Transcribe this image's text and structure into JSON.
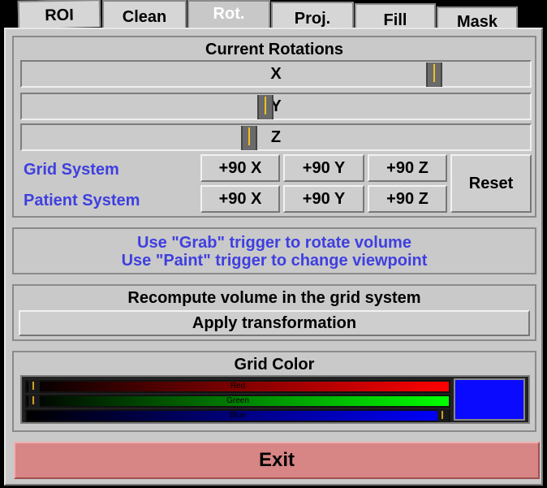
{
  "tabs": [
    {
      "label": "ROI"
    },
    {
      "label": "Clean"
    },
    {
      "label": "Rot."
    },
    {
      "label": "Proj."
    },
    {
      "label": "Fill"
    },
    {
      "label": "Mask"
    }
  ],
  "rotations": {
    "title": "Current Rotations",
    "sliders": [
      {
        "label": "X",
        "value": 0.86
      },
      {
        "label": "Y",
        "value": 0.48
      },
      {
        "label": "Z",
        "value": 0.45
      }
    ],
    "grid_system_label": "Grid System",
    "patient_system_label": "Patient System",
    "grid_buttons": [
      "+90 X",
      "+90 Y",
      "+90 Z"
    ],
    "patient_buttons": [
      "+90 X",
      "+90 Y",
      "+90 Z"
    ],
    "reset_label": "Reset"
  },
  "instructions": {
    "line1": "Use \"Grab\" trigger to rotate volume",
    "line2": "Use \"Paint\" trigger to change viewpoint"
  },
  "recompute": {
    "title": "Recompute volume in the grid system",
    "apply_label": "Apply transformation"
  },
  "grid_color": {
    "title": "Grid Color",
    "channels": [
      {
        "name": "Red",
        "value": 0.0
      },
      {
        "name": "Green",
        "value": 0.0
      },
      {
        "name": "Blue",
        "value": 1.0
      }
    ],
    "swatch_color": "#0a0aff"
  },
  "exit_label": "Exit",
  "colors": {
    "accent_text": "#3f3fe0",
    "panel_bg": "#c9c9c9",
    "exit_bg": "#d88585"
  }
}
